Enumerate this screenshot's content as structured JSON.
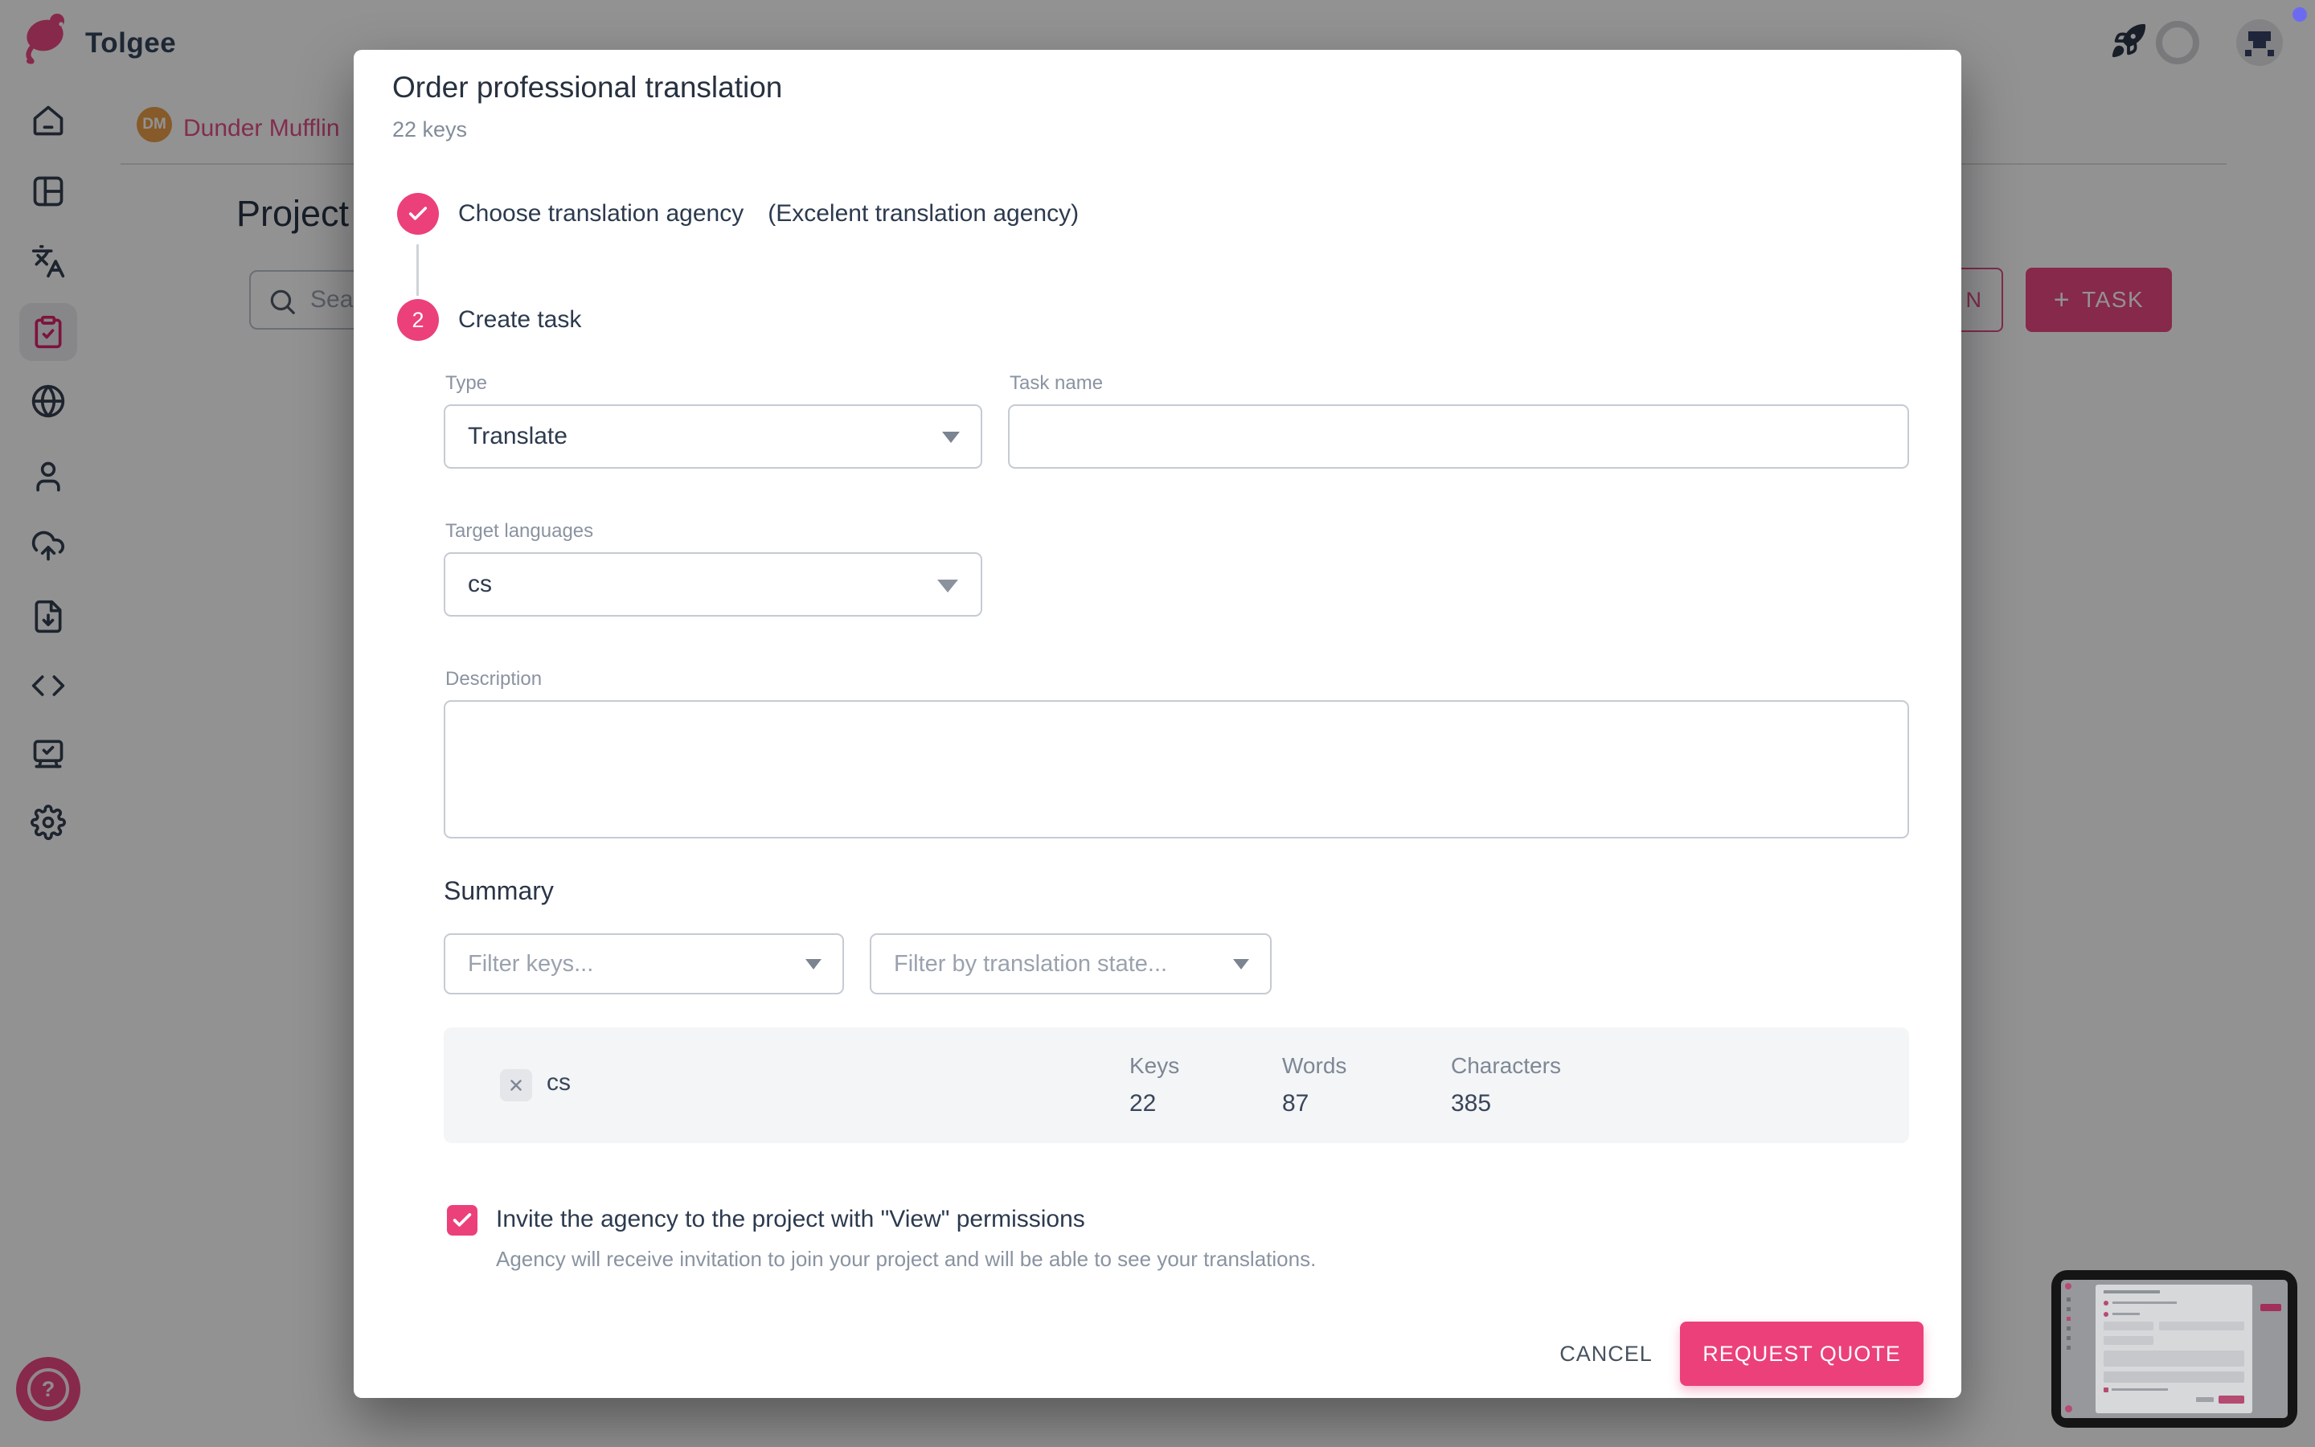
{
  "colors": {
    "accent": "#EC407A",
    "dark_text": "#2C3C52",
    "label_gray": "#8A93A1",
    "panel_gray": "#F4F5F7"
  },
  "header": {
    "logo_text": "Tolgee",
    "icons": [
      "mouse-logo-icon",
      "rocket-icon",
      "progress-ring",
      "user-avatar-identicon",
      "notification-dot"
    ]
  },
  "sidebar": {
    "items": [
      {
        "icon": "home-icon"
      },
      {
        "icon": "dashboard-icon"
      },
      {
        "icon": "translate-icon"
      },
      {
        "icon": "tasks-clipboard-icon",
        "active": true
      },
      {
        "icon": "globe-icon"
      },
      {
        "icon": "members-icon"
      },
      {
        "icon": "import-cloud-icon"
      },
      {
        "icon": "export-file-icon"
      },
      {
        "icon": "integrate-code-icon"
      },
      {
        "icon": "developer-monitor-icon"
      },
      {
        "icon": "settings-gear-icon"
      }
    ]
  },
  "page": {
    "breadcrumb": {
      "initials": "DM",
      "project": "Dunder Mufflin"
    },
    "title": "Project",
    "search_placeholder": "Sea",
    "order_button_visible": "N",
    "task_button_plus": "+",
    "task_button": "TASK",
    "help_label": "?"
  },
  "modal": {
    "title": "Order professional translation",
    "subtitle": "22 keys",
    "steps": [
      {
        "label": "Choose translation agency",
        "detail": "(Excelent translation agency)",
        "state": "done"
      },
      {
        "number": "2",
        "label": "Create task",
        "state": "active"
      }
    ],
    "form": {
      "type": {
        "label": "Type",
        "value": "Translate"
      },
      "task_name": {
        "label": "Task name",
        "value": ""
      },
      "target_languages": {
        "label": "Target languages",
        "value": "cs"
      },
      "description": {
        "label": "Description",
        "value": ""
      }
    },
    "summary": {
      "heading": "Summary",
      "filter_keys_placeholder": "Filter keys...",
      "filter_state_placeholder": "Filter by translation state...",
      "columns": {
        "keys": "Keys",
        "words": "Words",
        "characters": "Characters"
      },
      "rows": [
        {
          "language": "cs",
          "keys": "22",
          "words": "87",
          "characters": "385"
        }
      ]
    },
    "invite": {
      "checked": true,
      "label": "Invite the agency to the project with \"View\" permissions",
      "helper": "Agency will receive invitation to join your project and will be able to see your translations."
    },
    "actions": {
      "cancel": "CANCEL",
      "submit": "REQUEST QUOTE"
    }
  }
}
